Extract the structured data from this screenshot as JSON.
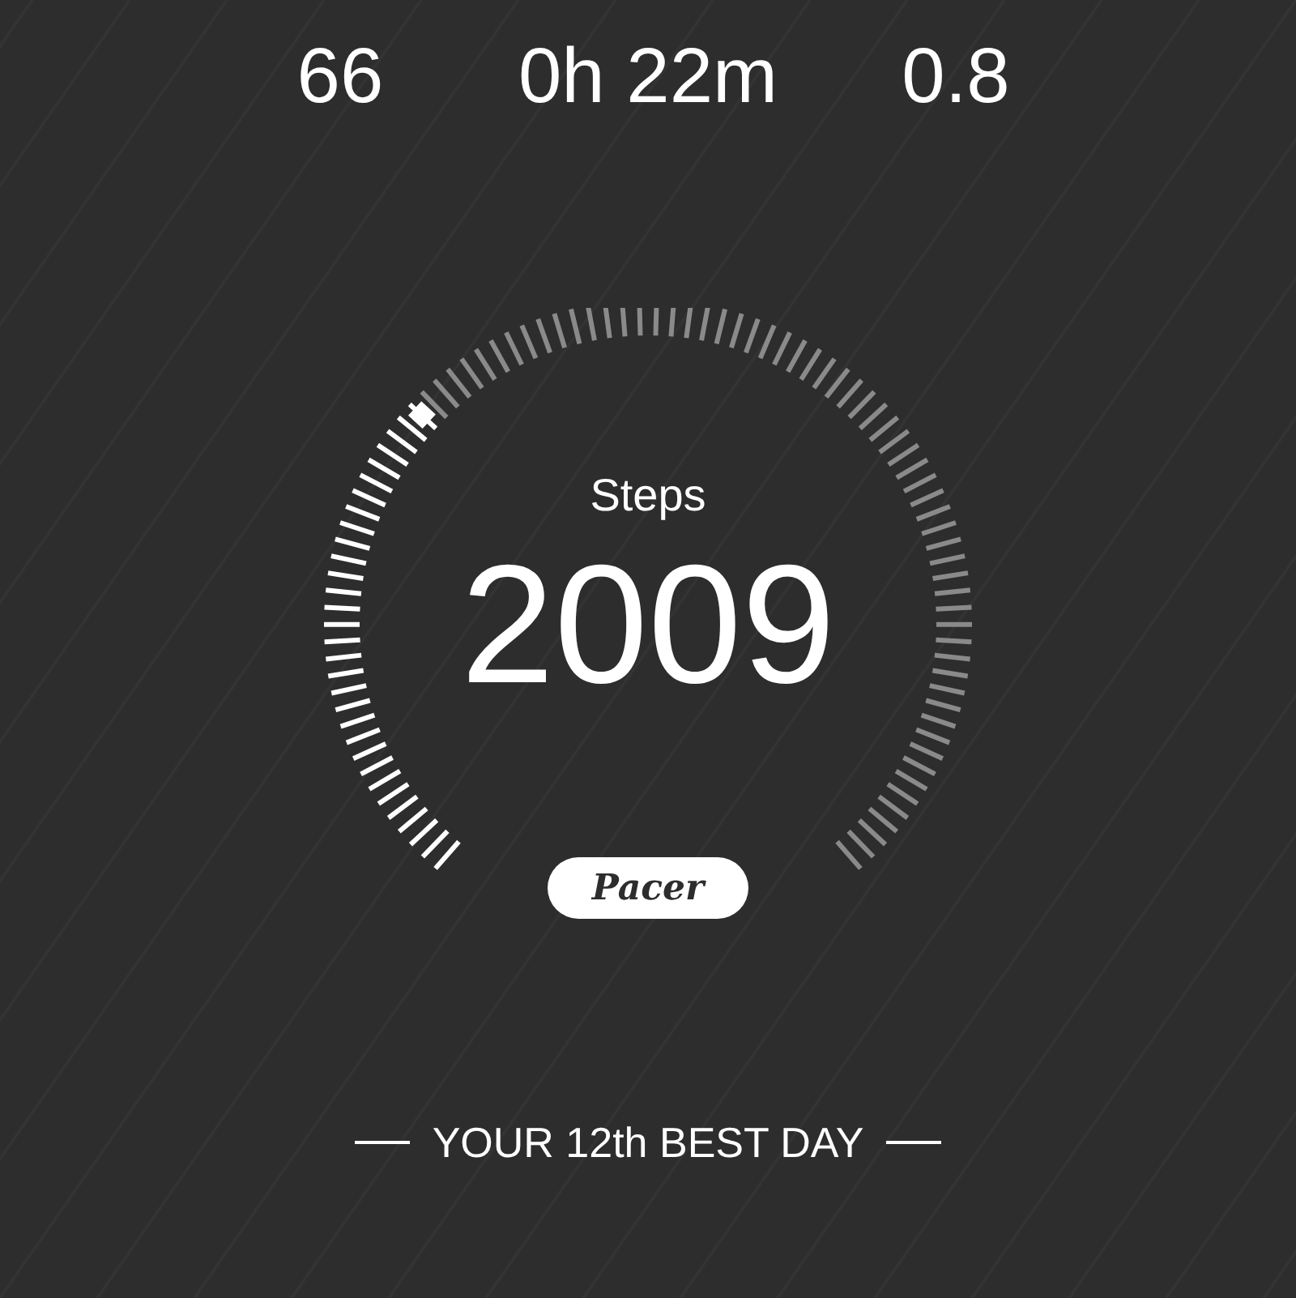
{
  "stats": [
    {
      "value": "66"
    },
    {
      "value": "0h 22m"
    },
    {
      "value": "0.8"
    }
  ],
  "gauge": {
    "label": "Steps",
    "value": "2009",
    "brand": "Pacer"
  },
  "rank": {
    "text": "YOUR 12th BEST DAY"
  }
}
